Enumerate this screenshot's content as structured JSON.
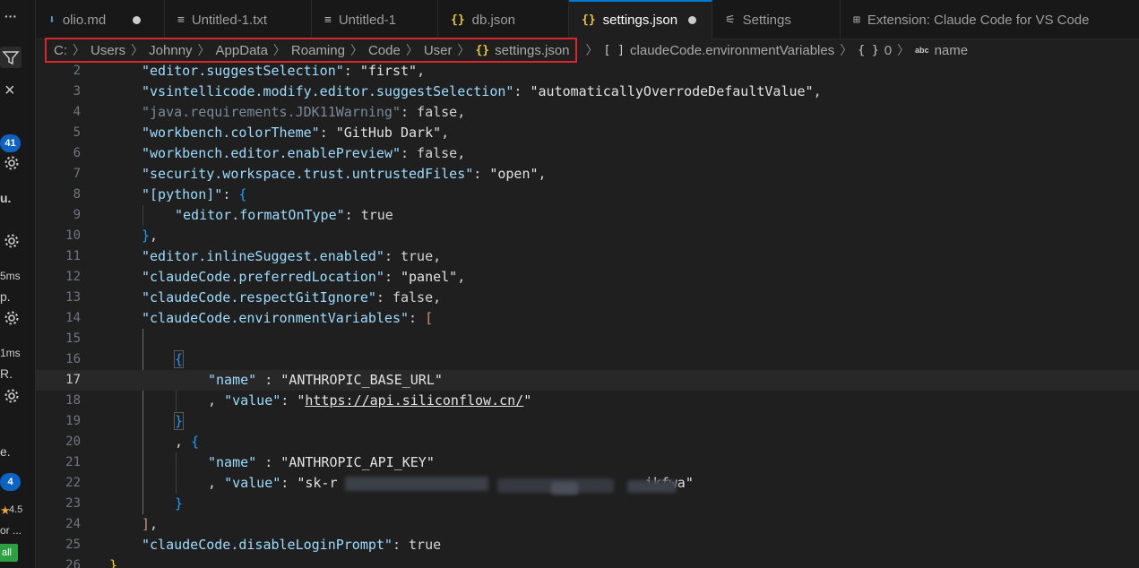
{
  "sidebar": {
    "more": "···",
    "close": "×",
    "badge1": "41",
    "truncated_title": "u.",
    "time1": "5ms",
    "truncated_p": "p.",
    "time2": "1ms",
    "truncated_r": "R.",
    "truncated_e": "e.",
    "badge2": "4",
    "rating": "4.5",
    "truncated_or": "or ...",
    "install_label": "all"
  },
  "tabs": [
    {
      "label": "olio.md",
      "icon": "markdown-icon",
      "modified": true
    },
    {
      "label": "Untitled-1.txt",
      "icon": "text-file-icon",
      "modified": false
    },
    {
      "label": "Untitled-1",
      "icon": "text-file-icon",
      "modified": false
    },
    {
      "label": "db.json",
      "icon": "json-icon",
      "modified": false
    },
    {
      "label": "settings.json",
      "icon": "json-icon",
      "modified": true,
      "active": true
    },
    {
      "label": "Settings",
      "icon": "settings-icon",
      "modified": false
    },
    {
      "label": "Extension: Claude Code for VS Code",
      "icon": "extension-icon",
      "modified": false
    }
  ],
  "breadcrumb": {
    "path": [
      "C:",
      "Users",
      "Johnny",
      "AppData",
      "Roaming",
      "Code",
      "User",
      "settings.json"
    ],
    "symbols": [
      "claudeCode.environmentVariables",
      "0",
      "name"
    ]
  },
  "editor": {
    "current_line": "17",
    "lines": [
      {
        "n": "2",
        "text": "\"editor.suggestSelection\": \"first\","
      },
      {
        "n": "3",
        "text": "\"vsintellicode.modify.editor.suggestSelection\": \"automaticallyOverrodeDefaultValue\","
      },
      {
        "n": "4",
        "text": "\"java.requirements.JDK11Warning\": false,"
      },
      {
        "n": "5",
        "text": "\"workbench.colorTheme\": \"GitHub Dark\","
      },
      {
        "n": "6",
        "text": "\"workbench.editor.enablePreview\": false,"
      },
      {
        "n": "7",
        "text": "\"security.workspace.trust.untrustedFiles\": \"open\","
      },
      {
        "n": "8",
        "text": "\"[python]\": {"
      },
      {
        "n": "9",
        "text": "\"editor.formatOnType\": true"
      },
      {
        "n": "10",
        "text": "},"
      },
      {
        "n": "11",
        "text": "\"editor.inlineSuggest.enabled\": true,"
      },
      {
        "n": "12",
        "text": "\"claudeCode.preferredLocation\": \"panel\","
      },
      {
        "n": "13",
        "text": "\"claudeCode.respectGitIgnore\": false,"
      },
      {
        "n": "14",
        "text": "\"claudeCode.environmentVariables\": ["
      },
      {
        "n": "15",
        "text": ""
      },
      {
        "n": "16",
        "text": "{"
      },
      {
        "n": "17",
        "text": "\"name\" : \"ANTHROPIC_BASE_URL\""
      },
      {
        "n": "18",
        "text": ", \"value\": \"https://api.siliconflow.cn/\""
      },
      {
        "n": "19",
        "text": "}"
      },
      {
        "n": "20",
        "text": ", {"
      },
      {
        "n": "21",
        "text": "\"name\" : \"ANTHROPIC_API_KEY\""
      },
      {
        "n": "22",
        "text": ", \"value\": \"sk-r ikfwa\""
      },
      {
        "n": "23",
        "text": "}"
      },
      {
        "n": "24",
        "text": "],"
      },
      {
        "n": "25",
        "text": "\"claudeCode.disableLoginPrompt\": true"
      },
      {
        "n": "26",
        "text": "}"
      }
    ]
  },
  "colors": {
    "accent": "#0078d4",
    "highlight_box": "#d9262e",
    "json_icon": "#e8c441",
    "string": "#ce9178",
    "key": "#9cdcfe"
  }
}
